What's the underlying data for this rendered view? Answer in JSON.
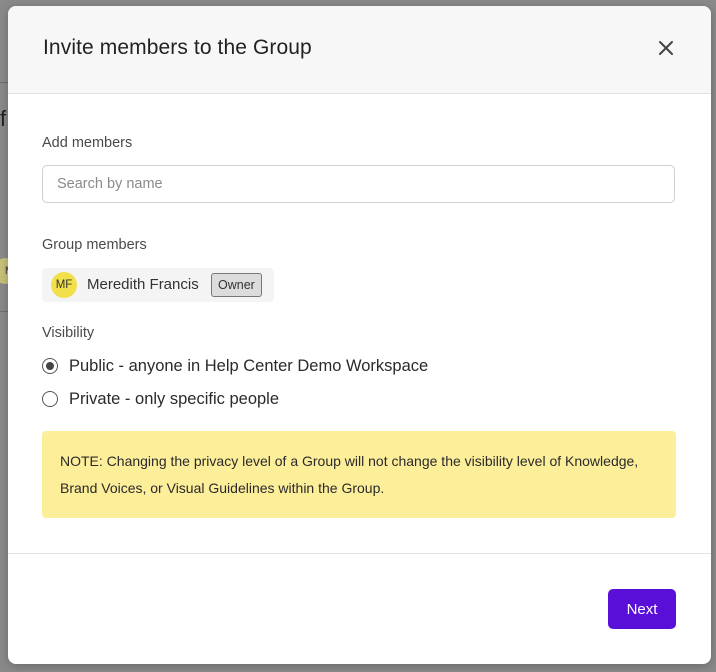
{
  "background": {
    "glyph": "f",
    "avatar_initial": "M"
  },
  "modal": {
    "title": "Invite members to the Group",
    "close_icon": "close-icon"
  },
  "add_members": {
    "label": "Add members",
    "search_placeholder": "Search by name",
    "search_value": ""
  },
  "group_members": {
    "label": "Group members",
    "members": [
      {
        "initials": "MF",
        "name": "Meredith Francis",
        "role": "Owner",
        "avatar_color": "#f2e04a"
      }
    ]
  },
  "visibility": {
    "label": "Visibility",
    "options": [
      {
        "label": "Public - anyone in Help Center Demo Workspace",
        "selected": true
      },
      {
        "label": "Private - only specific people",
        "selected": false
      }
    ]
  },
  "note": {
    "text": "NOTE: Changing the privacy level of a Group will not change the visibility level of Knowledge, Brand Voices, or Visual Guidelines within the Group.",
    "background_color": "#fdee9a"
  },
  "footer": {
    "next_label": "Next"
  },
  "colors": {
    "accent": "#5a0fd9",
    "overlay": "#8a8a8a"
  }
}
